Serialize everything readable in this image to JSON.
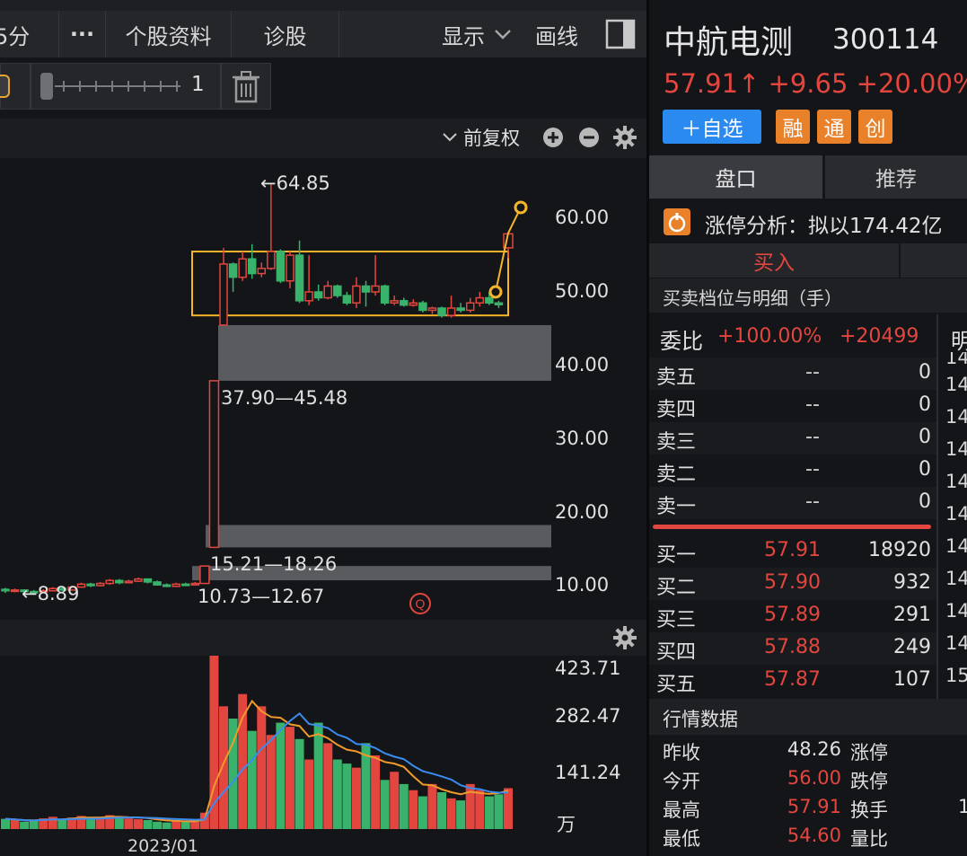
{
  "toolbar": {
    "period_label": "5分",
    "more_label": "···",
    "profile_label": "个股资料",
    "diagnose_label": "诊股",
    "display_label": "显示",
    "draw_label": "画线",
    "slider_value": "1"
  },
  "chart_header": {
    "adjust_label": "前复权"
  },
  "main_chart": {
    "y_axis": [
      "60.00",
      "50.00",
      "40.00",
      "30.00",
      "20.00",
      "10.00"
    ],
    "annotations": {
      "high": "←64.85",
      "low": "←8.89",
      "gap1": "37.90—45.48",
      "gap2": "15.21—18.26",
      "gap3": "10.73—12.67"
    }
  },
  "volume_chart": {
    "y_axis": [
      "423.71",
      "282.47",
      "141.24",
      "万"
    ],
    "x_label": "2023/01"
  },
  "stock": {
    "name": "中航电测",
    "code": "300114",
    "price": "57.91↑",
    "change": "+9.65",
    "change_pct": "+20.00%",
    "watch_label": "＋自选",
    "tags": [
      "融",
      "通",
      "创"
    ]
  },
  "tabs": {
    "panel": "盘口",
    "recommend": "推荐"
  },
  "limit_up": {
    "text": "涨停分析：拟以174.42亿"
  },
  "trade": {
    "buy_label": "买入",
    "depth_title": "买卖档位与明细（手）"
  },
  "order_book": {
    "ratio_label": "委比",
    "ratio_pct": "+100.00%",
    "ratio_diff": "+20499",
    "detail_label": "明",
    "asks": [
      {
        "label": "卖五",
        "price": "--",
        "vol": "0"
      },
      {
        "label": "卖四",
        "price": "--",
        "vol": "0"
      },
      {
        "label": "卖三",
        "price": "--",
        "vol": "0"
      },
      {
        "label": "卖二",
        "price": "--",
        "vol": "0"
      },
      {
        "label": "卖一",
        "price": "--",
        "vol": "0"
      }
    ],
    "bids": [
      {
        "label": "买一",
        "price": "57.91",
        "vol": "18920"
      },
      {
        "label": "买二",
        "price": "57.90",
        "vol": "932"
      },
      {
        "label": "买三",
        "price": "57.89",
        "vol": "291"
      },
      {
        "label": "买四",
        "price": "57.88",
        "vol": "249"
      },
      {
        "label": "买五",
        "price": "57.87",
        "vol": "107"
      }
    ],
    "time_col": [
      "14",
      "14",
      "14",
      "14",
      "14",
      "14",
      "14",
      "14",
      "14",
      "14",
      "15",
      "15"
    ]
  },
  "market_data": {
    "title": "行情数据",
    "rows": [
      {
        "label": "昨收",
        "value": "48.26",
        "label2": "涨停"
      },
      {
        "label": "今开",
        "value": "56.00",
        "label2": "跌停"
      },
      {
        "label": "最高",
        "value": "57.91",
        "label2": "换手"
      },
      {
        "label": "最低",
        "value": "54.60",
        "label2": "量比"
      }
    ],
    "extra": "1"
  },
  "colors": {
    "up": "#e2463e",
    "down": "#39b36b",
    "accent": "#2a8af0",
    "tag": "#e8812a",
    "box": "#f5b52a",
    "ma_orange": "#f09a2b",
    "ma_blue": "#3a8cf0"
  },
  "chart_data": [
    {
      "type": "candlestick",
      "title": "",
      "ylim": [
        5,
        70
      ],
      "y_ticks": [
        10,
        20,
        30,
        40,
        50,
        60
      ],
      "annotations": [
        "←64.85",
        "←8.89",
        "37.90—45.48",
        "15.21—18.26",
        "10.73—12.67"
      ],
      "series": [
        {
          "values": [
            [
              9.5,
              9.3,
              9.7,
              9.0
            ],
            [
              9.3,
              9.4,
              9.6,
              9.1
            ],
            [
              9.4,
              9.2,
              9.5,
              9.0
            ],
            [
              9.2,
              9.1,
              9.4,
              8.89
            ],
            [
              9.1,
              9.3,
              9.5,
              9.0
            ],
            [
              9.3,
              9.6,
              9.8,
              9.2
            ],
            [
              9.6,
              9.4,
              9.9,
              9.3
            ],
            [
              9.4,
              9.8,
              10.0,
              9.3
            ],
            [
              9.8,
              10.2,
              10.4,
              9.7
            ],
            [
              10.2,
              10.0,
              10.4,
              9.8
            ],
            [
              10.0,
              10.3,
              10.5,
              9.9
            ],
            [
              10.3,
              10.7,
              10.9,
              10.1
            ],
            [
              10.7,
              10.4,
              10.9,
              10.2
            ],
            [
              10.4,
              10.6,
              10.8,
              10.3
            ],
            [
              10.6,
              10.9,
              11.1,
              10.5
            ],
            [
              10.9,
              10.5,
              11.0,
              10.3
            ],
            [
              10.5,
              10.1,
              10.7,
              10.0
            ],
            [
              10.1,
              9.9,
              10.3,
              9.8
            ],
            [
              9.9,
              10.2,
              10.4,
              9.8
            ],
            [
              10.2,
              10.1,
              10.4,
              10.0
            ],
            [
              10.1,
              10.3,
              10.5,
              10.0
            ],
            [
              10.3,
              12.67,
              12.7,
              10.3
            ],
            [
              15.21,
              37.9,
              37.9,
              15.21
            ],
            [
              45.48,
              53.8,
              56,
              45.48
            ],
            [
              53.8,
              52.0,
              54,
              50
            ],
            [
              52.0,
              54.5,
              55.5,
              51.5
            ],
            [
              54.5,
              52.5,
              56.5,
              51.8
            ],
            [
              52.5,
              53.2,
              54,
              52
            ],
            [
              53.2,
              55.5,
              64.85,
              53
            ],
            [
              55.5,
              51.5,
              55.8,
              51.2
            ],
            [
              51.5,
              55.0,
              55.5,
              50.5
            ],
            [
              55.0,
              48.8,
              57,
              48.5
            ],
            [
              48.8,
              50.0,
              55,
              48.2
            ],
            [
              50.0,
              49.2,
              51,
              48.8
            ],
            [
              49.2,
              50.8,
              51.5,
              49
            ],
            [
              50.8,
              49.5,
              51,
              49.2
            ],
            [
              49.5,
              48.5,
              50,
              48.2
            ],
            [
              48.5,
              50.8,
              52,
              47.8
            ],
            [
              50.8,
              50.0,
              51.5,
              48
            ],
            [
              50.0,
              50.8,
              55,
              49.5
            ],
            [
              50.8,
              48.5,
              51,
              48.2
            ],
            [
              48.5,
              48.8,
              49.5,
              48.2
            ],
            [
              48.8,
              48.2,
              49.2,
              48
            ],
            [
              48.2,
              48.5,
              49,
              48
            ],
            [
              48.5,
              47.5,
              48.8,
              47.2
            ],
            [
              47.5,
              47.8,
              48,
              47
            ],
            [
              47.8,
              46.8,
              48,
              46.5
            ],
            [
              46.8,
              47.8,
              49.5,
              46.5
            ],
            [
              47.8,
              47.5,
              48.5,
              47.2
            ],
            [
              47.5,
              48.5,
              49.2,
              47.2
            ],
            [
              48.5,
              49.2,
              50,
              48
            ],
            [
              49.2,
              48.5,
              50,
              48.2
            ],
            [
              48.5,
              48.26,
              48.8,
              47.8
            ],
            [
              56.0,
              57.91,
              57.91,
              54.6
            ]
          ]
        }
      ]
    },
    {
      "type": "bar",
      "title": "",
      "x": [
        "2023/01"
      ],
      "ylim": [
        0,
        423.71
      ],
      "y_ticks": [
        "423.71",
        "282.47",
        "141.24",
        "万"
      ],
      "series": [
        {
          "values": [
            25,
            22,
            18,
            20,
            26,
            30,
            24,
            28,
            32,
            26,
            30,
            34,
            28,
            26,
            24,
            22,
            18,
            16,
            20,
            18,
            22,
            40,
            423.71,
            300,
            270,
            330,
            240,
            300,
            230,
            260,
            250,
            220,
            170,
            260,
            210,
            170,
            160,
            150,
            210,
            180,
            120,
            140,
            110,
            95,
            80,
            110,
            90,
            75,
            70,
            110,
            95,
            80,
            85,
            100
          ]
        }
      ]
    }
  ]
}
